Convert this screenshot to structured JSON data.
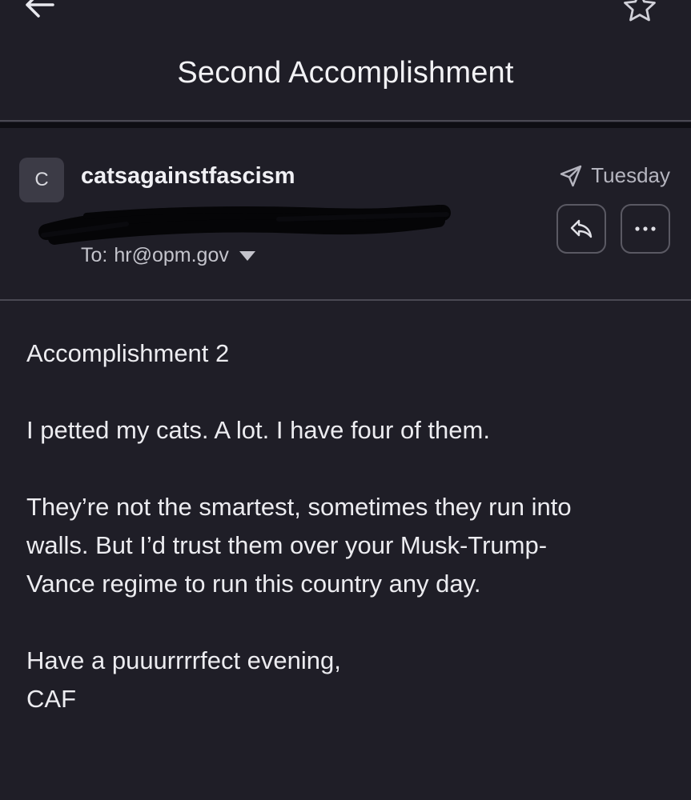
{
  "email": {
    "subject": "Second Accomplishment",
    "sender": {
      "avatar_initial": "C",
      "name": "catsagainstfascism"
    },
    "to_label": "To:",
    "to_address": "hr@opm.gov",
    "date": "Tuesday",
    "body": {
      "heading": "Accomplishment 2",
      "paragraph_1": "I petted my cats. A lot. I have four of them.",
      "paragraph_2_lines": [
        "They’re not the smartest, sometimes they run into",
        "walls. But I’d trust them over your Musk-Trump-",
        "Vance regime to run this country any day."
      ],
      "closing": "Have a puuurrrrfect evening,",
      "signature": "CAF"
    }
  },
  "icons": {
    "back": "arrow-left-icon",
    "star": "star-icon",
    "sent": "paper-plane-icon",
    "reply": "reply-icon",
    "more": "ellipsis-icon",
    "expand": "caret-down-icon"
  },
  "colors": {
    "background": "#1f1e27",
    "text": "#ececf0",
    "muted_text": "#b5b5bf",
    "divider": "#4a4953"
  }
}
